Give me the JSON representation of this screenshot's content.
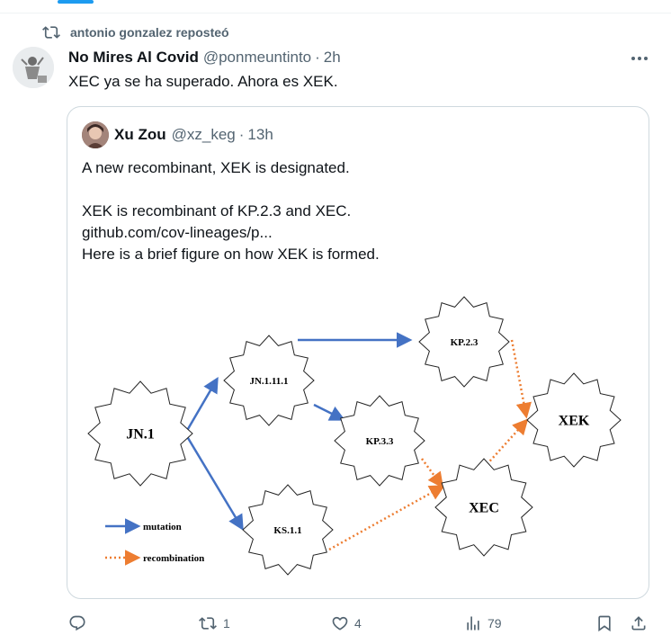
{
  "repost": {
    "text": "antonio gonzalez reposteó",
    "icon": "repost-icon"
  },
  "tweet": {
    "author_name": "No Mires Al Covid",
    "handle": "@ponmeuntinto",
    "separator": "·",
    "time": "2h",
    "text": "XEC ya se ha superado. Ahora es XEK."
  },
  "quote": {
    "author_name": "Xu Zou",
    "handle": "@xz_keg",
    "separator": "·",
    "time": "13h",
    "lines": [
      "A new recombinant, XEK is designated.",
      "XEK is recombinant of KP.2.3 and XEC.",
      "github.com/cov-lineages/p...",
      "Here is a brief figure on how XEK is formed."
    ]
  },
  "diagram": {
    "nodes": {
      "jn1": "JN.1",
      "jn11111": "JN.1.11.1",
      "kp23": "KP.2.3",
      "kp33": "KP.3.3",
      "ks11": "KS.1.1",
      "xec": "XEC",
      "xek": "XEK"
    },
    "legend": {
      "mutation": "mutation",
      "recombination": "recombination"
    },
    "colors": {
      "mutation": "#4472c4",
      "recombination": "#ed7d31"
    }
  },
  "actions": {
    "reply": {
      "icon": "reply-icon",
      "count": ""
    },
    "repost": {
      "icon": "repost-icon",
      "count": "1"
    },
    "like": {
      "icon": "heart-icon",
      "count": "4"
    },
    "views": {
      "icon": "views-icon",
      "count": "79"
    },
    "bookmark": {
      "icon": "bookmark-icon"
    },
    "share": {
      "icon": "share-icon"
    }
  },
  "colors": {
    "secondary_text": "#536471",
    "border": "#cfd9de",
    "accent": "#1d9bf0"
  }
}
